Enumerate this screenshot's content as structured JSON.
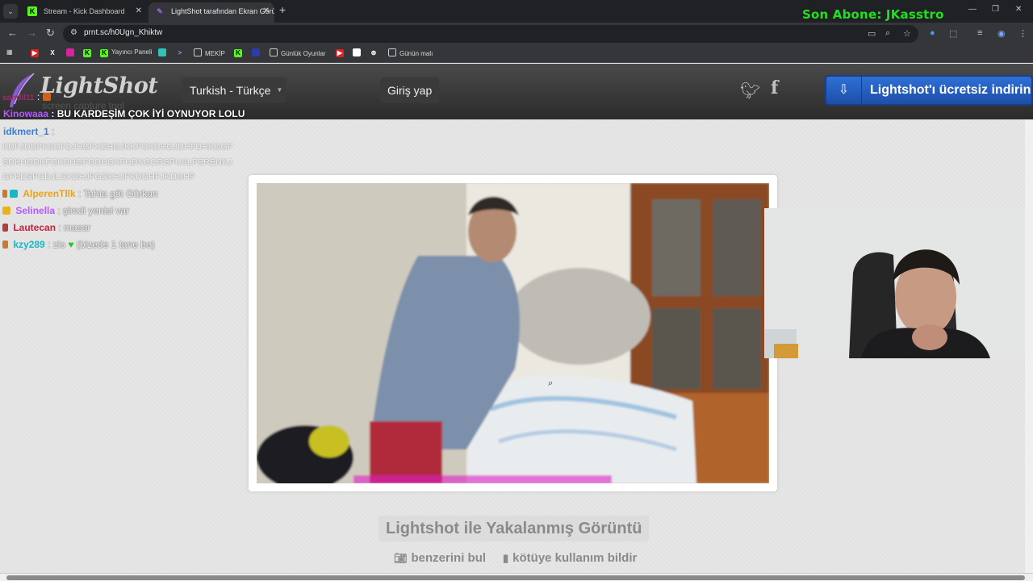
{
  "browser": {
    "tabs": [
      {
        "label": "Stream - Kick Dashboard",
        "favicon": "K",
        "favicon_color": "#53fc18"
      },
      {
        "label": "LightShot tarafından Ekran Görü",
        "favicon": "✎",
        "favicon_color": "#9b5de5"
      }
    ],
    "url": "prnt.sc/h0Ugn_Khiktw",
    "bookmarks": [
      {
        "label": "Yayıncı Paneli",
        "icon": "K"
      },
      {
        "label": "MEKİP",
        "icon": "folder"
      },
      {
        "label": "Günlük Oyunlar",
        "icon": "folder"
      },
      {
        "label": "Günün malı",
        "icon": "folder"
      }
    ]
  },
  "overlay": {
    "son_abone": "Son Abone: JKasstro"
  },
  "lightshot": {
    "logo": "LightShot",
    "tagline": "screen capture tool",
    "language": "Turkish - Türkçe",
    "login": "Giriş yap",
    "download_button": "Lightshot'ı ücretsiz indirin",
    "caption": "Lightshot ile Yakalanmış Görüntü",
    "actions": {
      "similar": "benzerini bul",
      "report": "kötüye kullanım bildir"
    }
  },
  "chat": [
    {
      "user": "sandil11",
      "user_color": "#9b2d6a",
      "text": ":"
    },
    {
      "user": "Kinowaaa",
      "user_color": "#b45aff",
      "text": ": BU KARDEŞİM ÇOK İYİ OYNUYOR LOLU"
    },
    {
      "user": "idkmert_1",
      "user_color": "#3d7fd6",
      "text": ":"
    },
    {
      "user": "AlperenTllk",
      "user_color": "#e8a41c",
      "text": ": Tahta göt Gürkan"
    },
    {
      "user": "Selinella",
      "user_color": "#b45aff",
      "text": ": şimdi yenisi var"
    },
    {
      "user": "Lautecan",
      "user_color": "#c81d3a",
      "text": ": masar"
    },
    {
      "user": "kzy289",
      "user_color": "#17b8c4",
      "text": ": zio"
    },
    {
      "user": "",
      "user_color": "#f2f2f2",
      "text": "(bizede 1 tane be)"
    }
  ],
  "chat_spam": [
    "KDFJDDFKSGFDJHGFKDHGJKKFGKDHGJDHFDHKGGF",
    "SDKHGDKFGKDHGFGDHGKFHDKGORSPUALPERENKJ",
    "GFKDSFGDJLGKDHJFGDKHJFKDGHFJKDGHF"
  ]
}
